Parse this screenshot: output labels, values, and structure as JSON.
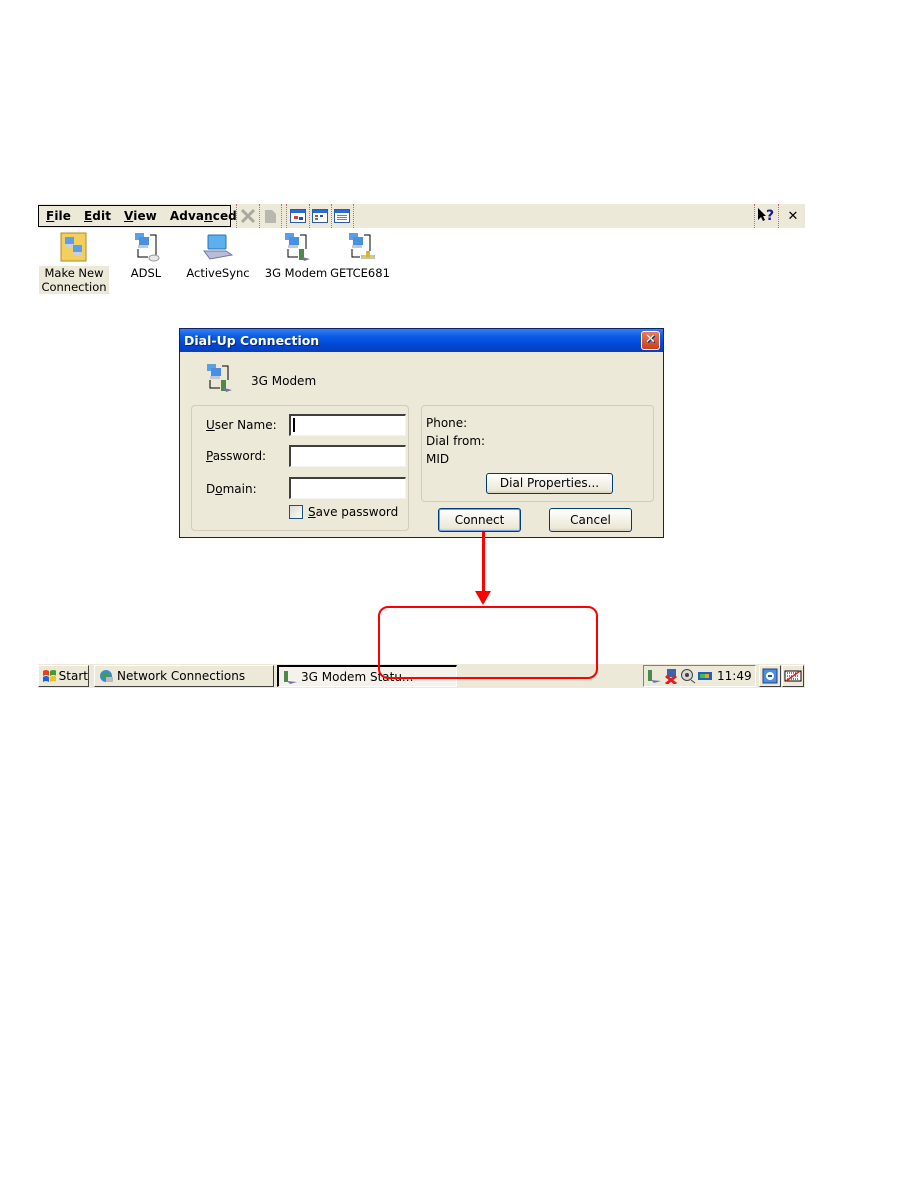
{
  "menubar": {
    "menus": [
      {
        "label": "File",
        "mnemonic": "F"
      },
      {
        "label": "Edit",
        "mnemonic": "E"
      },
      {
        "label": "View",
        "mnemonic": "V"
      },
      {
        "label": "Advanced",
        "mnemonic": "n"
      }
    ],
    "toolbar_icons": [
      "delete-icon",
      "properties-icon",
      "large-icons-view-icon",
      "small-icons-view-icon",
      "details-view-icon"
    ],
    "right_buttons": {
      "help": "?",
      "close": "✕"
    }
  },
  "desktop_icons": [
    {
      "label_line1": "Make New",
      "label_line2": "Connection",
      "icon": "make-new-connection-icon",
      "selected": true
    },
    {
      "label_line1": "ADSL",
      "label_line2": "",
      "icon": "adsl-connection-icon"
    },
    {
      "label_line1": "ActiveSync",
      "label_line2": "",
      "icon": "activesync-icon"
    },
    {
      "label_line1": "3G Modem",
      "label_line2": "",
      "icon": "modem-connection-icon"
    },
    {
      "label_line1": "GETCE681",
      "label_line2": "",
      "icon": "lan-connection-icon"
    }
  ],
  "dialog": {
    "title": "Dial-Up Connection",
    "close_label": "✕",
    "connection_name": "3G Modem",
    "fields": {
      "user_name": {
        "label": "User Name:",
        "value": ""
      },
      "password": {
        "label": "Password:",
        "value": ""
      },
      "domain": {
        "label": "Domain:",
        "value": ""
      }
    },
    "save_password": {
      "label": "Save password",
      "checked": false
    },
    "info": {
      "phone_label": "Phone:",
      "dial_from_label": "Dial from:",
      "dial_from_value": "MID"
    },
    "dial_properties_label": "Dial Properties...",
    "connect_label": "Connect",
    "cancel_label": "Cancel"
  },
  "annotation": {
    "color": "#ff0000",
    "callout_text": ""
  },
  "taskbar": {
    "start_label": "Start",
    "tasks": [
      {
        "label": "Network Connections",
        "active": false
      },
      {
        "label": "3G Modem Statu...",
        "active": true
      }
    ],
    "clock": "11:49"
  },
  "colors": {
    "window_bg": "#ece9d8",
    "titlebar": "#0046d5",
    "accent_red": "#ff0000"
  }
}
